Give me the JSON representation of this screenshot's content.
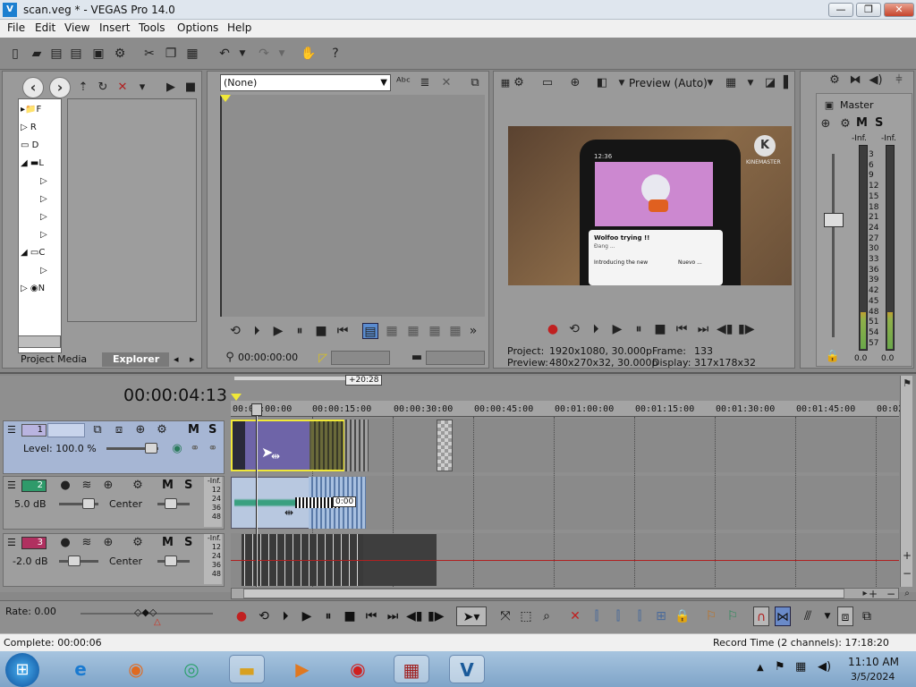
{
  "window": {
    "title": "scan.veg * - VEGAS Pro 14.0",
    "min": "—",
    "max": "❐",
    "close": "✕"
  },
  "menu": [
    "File",
    "Edit",
    "View",
    "Insert",
    "Tools",
    "Options",
    "Help"
  ],
  "explorer": {
    "tree_items": [
      "F",
      "R",
      "D",
      "L",
      "",
      "",
      "",
      "",
      "C",
      "",
      "N"
    ],
    "tabs": {
      "project_media": "Project Media",
      "explorer": "Explorer"
    }
  },
  "trimmer": {
    "dropdown": "(None)",
    "timecode": "00:00:00:00"
  },
  "preview": {
    "mode": "Preview (Auto)",
    "project_label": "Project:",
    "project_value": "1920x1080, 30.000p",
    "preview_label": "Preview:",
    "preview_value": "480x270x32, 30.000p",
    "frame_label": "Frame:",
    "frame_value": "133",
    "display_label": "Display:",
    "display_value": "317x178x32",
    "watermark": "KINEMASTER",
    "phone_text1": "Wolfoo trying !!",
    "phone_text2": "Đang ...",
    "phone_text3": "Introducing the new",
    "phone_text4": "Nuevo ...",
    "phone_time": "12:36"
  },
  "master": {
    "label": "Master",
    "m": "M",
    "s": "S",
    "inf_l": "-Inf.",
    "inf_r": "-Inf.",
    "bottom_l": "0.0",
    "bottom_r": "0.0",
    "scale": [
      "3",
      "6",
      "9",
      "12",
      "15",
      "18",
      "21",
      "24",
      "27",
      "30",
      "33",
      "36",
      "39",
      "42",
      "45",
      "48",
      "51",
      "54",
      "57"
    ]
  },
  "timeline": {
    "time": "00:00:04:13",
    "marker": "+20:28",
    "ruler": [
      "00:00:00:00",
      "00:00:15:00",
      "00:00:30:00",
      "00:00:45:00",
      "00:01:00:00",
      "00:01:15:00",
      "00:01:30:00",
      "00:01:45:00",
      "00:02"
    ],
    "clip_label": "0:00"
  },
  "tracks": [
    {
      "num": "1",
      "level": "Level: 100.0 %",
      "m": "M",
      "s": "S",
      "color": "#b9b4e0"
    },
    {
      "num": "2",
      "level": "5.0 dB",
      "pan": "Center",
      "m": "M",
      "s": "S",
      "meter": [
        "-Inf.",
        "12",
        "24",
        "36",
        "48"
      ],
      "color": "#2f9a6a"
    },
    {
      "num": "3",
      "level": "-2.0 dB",
      "pan": "Center",
      "m": "M",
      "s": "S",
      "meter": [
        "-Inf.",
        "12",
        "24",
        "36",
        "48"
      ],
      "color": "#b03060"
    }
  ],
  "rate": "Rate: 0.00",
  "status": {
    "left": "Complete: 00:00:06",
    "right": "Record Time (2 channels): 17:18:20"
  },
  "clock": {
    "time": "11:10 AM",
    "date": "3/5/2024"
  },
  "colors": {
    "accent_yellow": "#f0e838",
    "track1_bg": "#a6b6d4",
    "clip_purple": "#6e64a8"
  }
}
